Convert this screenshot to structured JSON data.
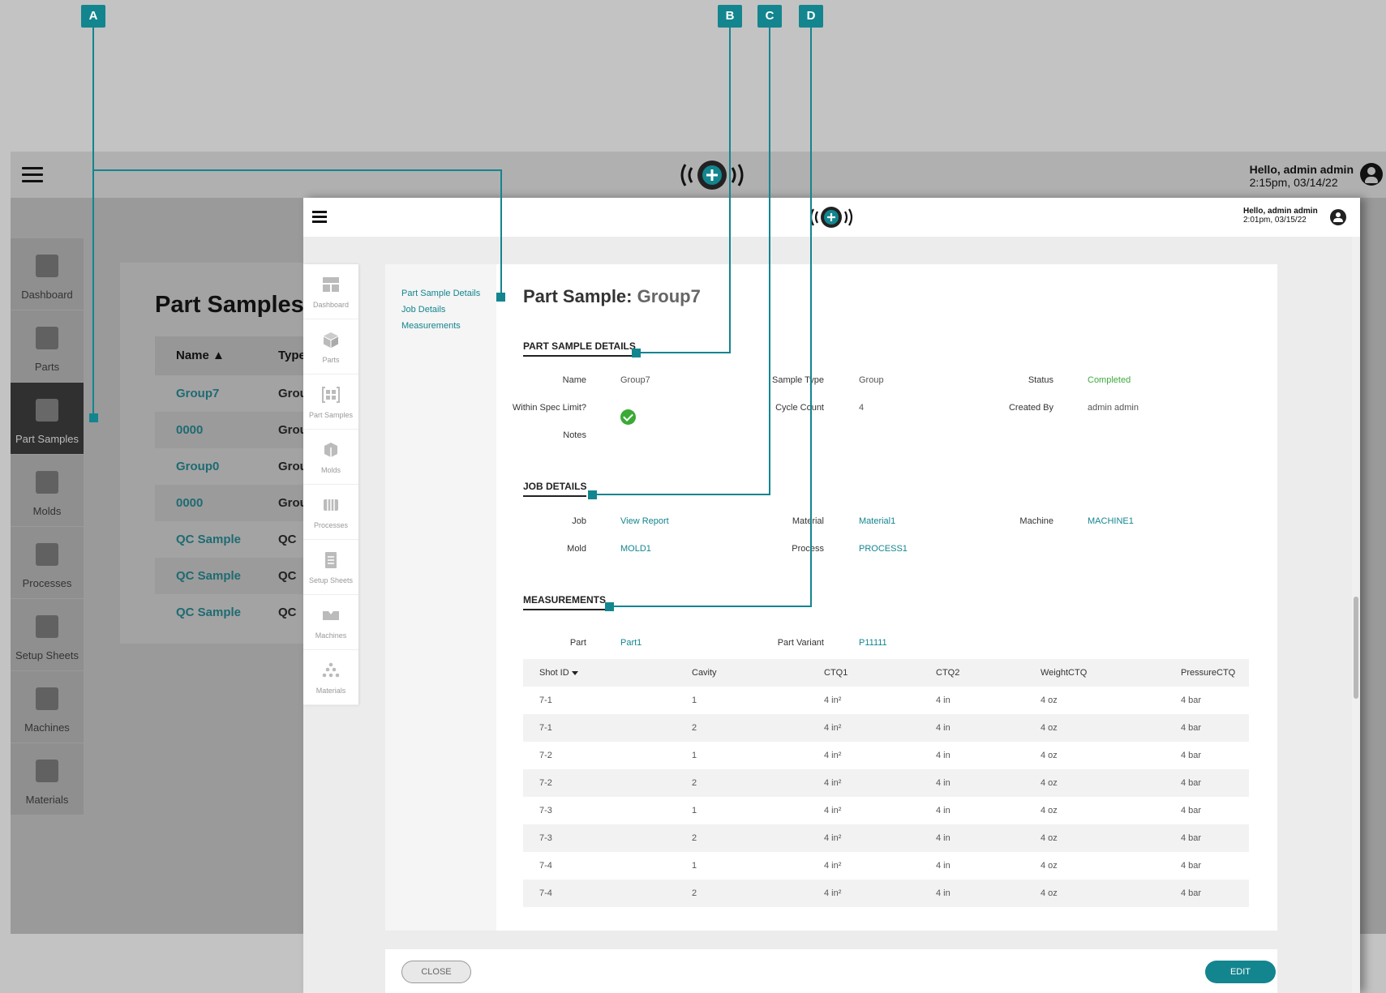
{
  "back_app": {
    "user": {
      "greeting": "Hello, admin admin",
      "time": "2:15pm, 03/14/22"
    },
    "nav": [
      {
        "label": "Dashboard",
        "icon": "dashboard-icon"
      },
      {
        "label": "Parts",
        "icon": "parts-icon"
      },
      {
        "label": "Part Samples",
        "icon": "part-samples-icon"
      },
      {
        "label": "Molds",
        "icon": "molds-icon"
      },
      {
        "label": "Processes",
        "icon": "processes-icon"
      },
      {
        "label": "Setup Sheets",
        "icon": "setup-sheets-icon"
      },
      {
        "label": "Machines",
        "icon": "machines-icon"
      },
      {
        "label": "Materials",
        "icon": "materials-icon"
      }
    ],
    "page_title": "Part Samples",
    "table": {
      "columns": [
        "Name ▲",
        "Type"
      ],
      "rows": [
        {
          "name": "Group7",
          "type": "Grou"
        },
        {
          "name": "0000",
          "type": "Grou"
        },
        {
          "name": "Group0",
          "type": "Grou"
        },
        {
          "name": "0000",
          "type": "Grou"
        },
        {
          "name": "QC Sample",
          "type": "QC"
        },
        {
          "name": "QC Sample",
          "type": "QC"
        },
        {
          "name": "QC Sample",
          "type": "QC"
        }
      ]
    }
  },
  "front_app": {
    "user": {
      "greeting": "Hello, admin admin",
      "time": "2:01pm, 03/15/22"
    },
    "nav": [
      {
        "label": "Dashboard",
        "icon": "dashboard-icon"
      },
      {
        "label": "Parts",
        "icon": "parts-icon"
      },
      {
        "label": "Part Samples",
        "icon": "part-samples-icon"
      },
      {
        "label": "Molds",
        "icon": "molds-icon"
      },
      {
        "label": "Processes",
        "icon": "processes-icon"
      },
      {
        "label": "Setup Sheets",
        "icon": "setup-sheets-icon"
      },
      {
        "label": "Machines",
        "icon": "machines-icon"
      },
      {
        "label": "Materials",
        "icon": "materials-icon"
      }
    ],
    "toc": [
      "Part Sample Details",
      "Job Details",
      "Measurements"
    ],
    "title_prefix": "Part Sample:",
    "title_value": "Group7",
    "part_sample_details": {
      "heading": "PART SAMPLE DETAILS",
      "name_label": "Name",
      "name_value": "Group7",
      "spec_label": "Within Spec Limit?",
      "notes_label": "Notes",
      "sample_type_label": "Sample Type",
      "sample_type_value": "Group",
      "cycle_count_label": "Cycle Count",
      "cycle_count_value": "4",
      "status_label": "Status",
      "status_value": "Completed",
      "created_by_label": "Created By",
      "created_by_value": "admin admin"
    },
    "job_details": {
      "heading": "JOB DETAILS",
      "job_label": "Job",
      "job_value": "View Report",
      "mold_label": "Mold",
      "mold_value": "MOLD1",
      "material_label": "Material",
      "material_value": "Material1",
      "process_label": "Process",
      "process_value": "PROCESS1",
      "machine_label": "Machine",
      "machine_value": "MACHINE1"
    },
    "measurements": {
      "heading": "MEASUREMENTS",
      "part_label": "Part",
      "part_value": "Part1",
      "variant_label": "Part Variant",
      "variant_value": "P11111",
      "columns": [
        "Shot ID",
        "Cavity",
        "CTQ1",
        "CTQ2",
        "WeightCTQ",
        "PressureCTQ"
      ],
      "rows": [
        [
          "7-1",
          "1",
          "4 in²",
          "4 in",
          "4 oz",
          "4 bar"
        ],
        [
          "7-1",
          "2",
          "4 in²",
          "4 in",
          "4 oz",
          "4 bar"
        ],
        [
          "7-2",
          "1",
          "4 in²",
          "4 in",
          "4 oz",
          "4 bar"
        ],
        [
          "7-2",
          "2",
          "4 in²",
          "4 in",
          "4 oz",
          "4 bar"
        ],
        [
          "7-3",
          "1",
          "4 in²",
          "4 in",
          "4 oz",
          "4 bar"
        ],
        [
          "7-3",
          "2",
          "4 in²",
          "4 in",
          "4 oz",
          "4 bar"
        ],
        [
          "7-4",
          "1",
          "4 in²",
          "4 in",
          "4 oz",
          "4 bar"
        ],
        [
          "7-4",
          "2",
          "4 in²",
          "4 in",
          "4 oz",
          "4 bar"
        ]
      ]
    },
    "close_label": "CLOSE",
    "edit_label": "EDIT"
  },
  "callouts": [
    "A",
    "B",
    "C",
    "D"
  ],
  "colors": {
    "accent": "#13858f",
    "success": "#3aaa35",
    "back_overlay": "#9a9a9a"
  }
}
